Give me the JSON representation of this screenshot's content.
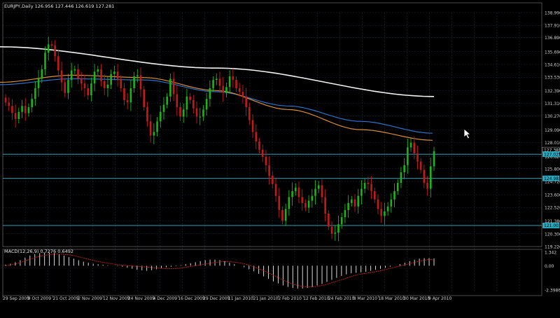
{
  "window": {
    "symbol_header": "EURJPY,Daily 126.956 127.446 126.619 127.281"
  },
  "indicator": {
    "label": "MACD(12,26,9) 0.7276 0.6492"
  },
  "colors": {
    "background": "#000000",
    "grid": "#1e2a3a",
    "bull_candle": "#1bb51b",
    "bear_candle": "#c21b1b",
    "ma_white": "#f2f2f2",
    "ma_blue": "#2f72c7",
    "ma_orange": "#d98f3c",
    "hline": "#38b6c8",
    "label_bg": "#2aa9bf",
    "macd_hist": "#d8d8d8",
    "macd_signal": "#c42020",
    "axis_text": "#cfcfcf"
  },
  "chart_data": {
    "type": "candlestick",
    "price_axis": {
      "ticks": [
        "138.990",
        "137.910",
        "136.890",
        "135.690",
        "134.610",
        "133.530",
        "132.390",
        "131.310",
        "130.270",
        "129.090",
        "128.010",
        "126.820",
        "125.800",
        "124.720",
        "123.600",
        "122.520",
        "121.380",
        "120.300",
        "119.220"
      ],
      "ylim": [
        119.22,
        138.99
      ]
    },
    "price_labels": [
      {
        "text": "127.381",
        "value": 127.381,
        "style": "outline"
      },
      {
        "text": "127.025",
        "value": 127.025,
        "style": "filled"
      },
      {
        "text": "124.981",
        "value": 124.981,
        "style": "filled"
      },
      {
        "text": "121.001",
        "value": 121.001,
        "style": "filled"
      }
    ],
    "horizontal_lines": [
      127.025,
      124.981,
      121.001
    ],
    "x_labels": [
      "29 Sep 2009",
      "9 Oct 2009",
      "21 Oct 2009",
      "2 Nov 2009",
      "12 Nov 2009",
      "24 Nov 2009",
      "4 Dec 2009",
      "16 Dec 2009",
      "29 Dec 2009",
      "11 Jan 2010",
      "21 Jan 2010",
      "2 Feb 2010",
      "12 Feb 2010",
      "24 Feb 2010",
      "8 Mar 2010",
      "18 Mar 2010",
      "30 Mar 2010",
      "9 Apr 2010"
    ],
    "closes": [
      131.4,
      131.1,
      130.5,
      130.0,
      130.6,
      131.1,
      130.5,
      131.0,
      131.7,
      132.6,
      133.4,
      134.2,
      135.6,
      136.3,
      136.2,
      135.3,
      134.1,
      133.1,
      132.2,
      133.3,
      134.1,
      134.2,
      133.4,
      133.0,
      132.6,
      132.0,
      133.0,
      134.0,
      134.2,
      133.2,
      132.6,
      132.9,
      133.8,
      134.0,
      133.4,
      132.6,
      131.6,
      131.4,
      132.6,
      133.6,
      133.7,
      132.5,
      131.0,
      129.8,
      128.6,
      128.9,
      129.8,
      130.6,
      131.2,
      131.9,
      133.4,
      132.1,
      131.0,
      130.2,
      130.8,
      131.9,
      131.6,
      130.9,
      130.2,
      130.2,
      130.8,
      131.7,
      132.6,
      133.3,
      133.4,
      132.8,
      132.2,
      132.7,
      133.6,
      133.3,
      132.6,
      132.3,
      131.9,
      131.0,
      129.9,
      128.9,
      128.1,
      127.4,
      126.8,
      126.1,
      125.2,
      124.5,
      123.5,
      122.3,
      121.4,
      122.4,
      123.4,
      123.9,
      124.2,
      123.4,
      122.9,
      122.5,
      123.1,
      123.5,
      124.1,
      124.4,
      123.4,
      122.0,
      120.9,
      120.3,
      120.4,
      121.1,
      121.7,
      122.3,
      122.9,
      123.2,
      122.6,
      123.5,
      124.1,
      124.6,
      124.5,
      123.9,
      123.2,
      122.4,
      121.8,
      122.2,
      122.6,
      123.2,
      123.9,
      124.6,
      125.5,
      126.1,
      127.6,
      128.0,
      127.1,
      126.4,
      125.7,
      124.6,
      124.1,
      126.0,
      127.28
    ],
    "series": [
      {
        "values": [
          136.1,
          134.3,
          131.9
        ]
      },
      {
        "values": [
          132.9,
          133.4,
          133.3,
          132.3,
          131.1,
          129.8,
          128.8
        ]
      },
      {
        "values": [
          133.1,
          133.7,
          133.5,
          132.4,
          130.8,
          129.1,
          128.2
        ]
      }
    ],
    "macd": {
      "ylim": [
        -2.3986,
        1.342
      ],
      "tick_labels": [
        "1.342",
        "0.00",
        "-2.3986"
      ],
      "histogram": [
        0.1,
        0.2,
        0.35,
        0.55,
        0.8,
        1.0,
        1.15,
        1.25,
        1.3,
        1.3,
        1.25,
        1.15,
        1.0,
        0.85,
        0.7,
        0.55,
        0.4,
        0.3,
        0.2,
        0.15,
        0.1,
        0.05,
        0.0,
        -0.05,
        -0.1,
        -0.2,
        -0.3,
        -0.4,
        -0.45,
        -0.5,
        -0.45,
        -0.35,
        -0.25,
        -0.15,
        -0.1,
        -0.05,
        0.05,
        0.15,
        0.25,
        0.35,
        0.45,
        0.55,
        0.6,
        0.6,
        0.55,
        0.45,
        0.3,
        0.15,
        0.0,
        -0.15,
        -0.35,
        -0.55,
        -0.8,
        -1.05,
        -1.3,
        -1.55,
        -1.75,
        -1.95,
        -2.1,
        -2.2,
        -2.25,
        -2.25,
        -2.2,
        -2.1,
        -1.95,
        -1.8,
        -1.6,
        -1.4,
        -1.2,
        -1.0,
        -0.85,
        -0.75,
        -0.7,
        -0.65,
        -0.6,
        -0.5,
        -0.4,
        -0.3,
        -0.2,
        -0.1,
        0.0,
        0.15,
        0.3,
        0.45,
        0.6,
        0.7,
        0.75,
        0.75,
        0.73
      ],
      "signal": [
        0.0,
        0.1,
        0.25,
        0.45,
        0.65,
        0.85,
        1.0,
        1.1,
        1.15,
        1.15,
        1.1,
        1.0,
        0.85,
        0.7,
        0.55,
        0.4,
        0.3,
        0.2,
        0.1,
        0.05,
        0.0,
        -0.05,
        -0.1,
        -0.15,
        -0.2,
        -0.25,
        -0.3,
        -0.3,
        -0.25,
        -0.15,
        -0.05,
        0.05,
        0.15,
        0.25,
        0.35,
        0.4,
        0.4,
        0.35,
        0.25,
        0.1,
        -0.1,
        -0.35,
        -0.6,
        -0.9,
        -1.2,
        -1.5,
        -1.75,
        -1.95,
        -2.05,
        -2.1,
        -2.05,
        -1.95,
        -1.8,
        -1.6,
        -1.4,
        -1.2,
        -1.0,
        -0.85,
        -0.75,
        -0.65,
        -0.55,
        -0.4,
        -0.25,
        -0.1,
        0.05,
        0.2,
        0.35,
        0.5,
        0.6,
        0.65
      ]
    }
  }
}
